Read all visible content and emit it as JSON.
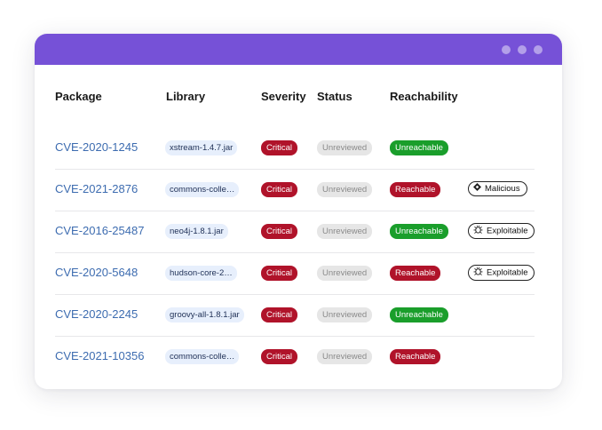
{
  "colors": {
    "titlebar": "#7651d7",
    "critical": "#b0132a",
    "unreachable": "#1a9e2b",
    "reachable": "#b0132a",
    "link": "#3d6cb0"
  },
  "headers": {
    "package": "Package",
    "library": "Library",
    "severity": "Severity",
    "status": "Status",
    "reachability": "Reachability"
  },
  "rows": [
    {
      "cve": "CVE-2020-1245",
      "library": "xstream-1.4.7.jar",
      "severity": "Critical",
      "status": "Unreviewed",
      "reachability": "Unreachable",
      "tag": "",
      "tag_icon": ""
    },
    {
      "cve": "CVE-2021-2876",
      "library": "commons-colle…",
      "severity": "Critical",
      "status": "Unreviewed",
      "reachability": "Reachable",
      "tag": "Malicious",
      "tag_icon": "diamond-icon"
    },
    {
      "cve": "CVE-2016-25487",
      "library": "neo4j-1.8.1.jar",
      "severity": "Critical",
      "status": "Unreviewed",
      "reachability": "Unreachable",
      "tag": "Exploitable",
      "tag_icon": "bug-icon"
    },
    {
      "cve": "CVE-2020-5648",
      "library": "hudson-core-2…",
      "severity": "Critical",
      "status": "Unreviewed",
      "reachability": "Reachable",
      "tag": "Exploitable",
      "tag_icon": "bug-icon"
    },
    {
      "cve": "CVE-2020-2245",
      "library": "groovy-all-1.8.1.jar",
      "severity": "Critical",
      "status": "Unreviewed",
      "reachability": "Unreachable",
      "tag": "",
      "tag_icon": ""
    },
    {
      "cve": "CVE-2021-10356",
      "library": "commons-colle…",
      "severity": "Critical",
      "status": "Unreviewed",
      "reachability": "Reachable",
      "tag": "",
      "tag_icon": ""
    }
  ]
}
